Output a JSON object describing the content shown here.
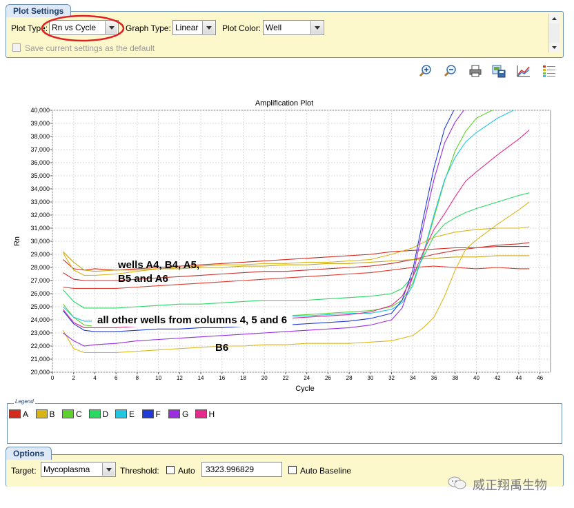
{
  "plot_settings": {
    "title": "Plot Settings",
    "plot_type_label": "Plot Type:",
    "plot_type_value": "Rn vs Cycle",
    "graph_type_label": "Graph Type:",
    "graph_type_value": "Linear",
    "plot_color_label": "Plot Color:",
    "plot_color_value": "Well",
    "save_default_label": "Save current settings as the default",
    "save_default_checked": false
  },
  "toolbar": {
    "icons": [
      "zoom-in-icon",
      "zoom-out-icon",
      "print-icon",
      "save-image-icon",
      "chart-icon",
      "legend-list-icon"
    ]
  },
  "chart_data": {
    "type": "line",
    "title": "Amplification Plot",
    "xlabel": "Cycle",
    "ylabel": "Rn",
    "xlim": [
      0,
      47
    ],
    "ylim": [
      20000,
      40000
    ],
    "x_ticks": [
      0,
      2,
      4,
      6,
      8,
      10,
      12,
      14,
      16,
      18,
      20,
      22,
      24,
      26,
      28,
      30,
      32,
      34,
      36,
      38,
      40,
      42,
      44,
      46
    ],
    "y_ticks": [
      20000,
      21000,
      22000,
      23000,
      24000,
      25000,
      26000,
      27000,
      28000,
      29000,
      30000,
      31000,
      32000,
      33000,
      34000,
      35000,
      36000,
      37000,
      38000,
      39000,
      40000
    ],
    "y_tick_labels": [
      "20,000",
      "21,000",
      "22,000",
      "23,000",
      "24,000",
      "25,000",
      "26,000",
      "27,000",
      "28,000",
      "29,000",
      "30,000",
      "31,000",
      "32,000",
      "33,000",
      "34,000",
      "35,000",
      "36,000",
      "37,000",
      "38,000",
      "39,000",
      "40,000"
    ],
    "grid": true,
    "series": [
      {
        "name": "A",
        "color": "#d52b1e",
        "x": [
          1,
          2,
          3,
          4,
          6,
          8,
          10,
          12,
          14,
          16,
          18,
          20,
          22,
          24,
          26,
          28,
          30,
          32,
          34,
          36,
          38,
          40,
          42,
          44,
          45
        ],
        "values": [
          28600,
          27900,
          27800,
          27900,
          27800,
          27900,
          28000,
          28100,
          28200,
          28300,
          28400,
          28500,
          28600,
          28700,
          28800,
          28900,
          29000,
          29200,
          29300,
          29400,
          29500,
          29500,
          29600,
          29600,
          29600
        ]
      },
      {
        "name": "A",
        "color": "#c9302c",
        "x": [
          1,
          2,
          3,
          4,
          6,
          8,
          10,
          12,
          14,
          16,
          18,
          20,
          22,
          24,
          26,
          28,
          30,
          32,
          34,
          36,
          38,
          40,
          42,
          44,
          45
        ],
        "values": [
          27600,
          27100,
          27000,
          27000,
          27000,
          27100,
          27200,
          27300,
          27400,
          27500,
          27600,
          27700,
          27700,
          27800,
          27900,
          28000,
          28100,
          28300,
          28600,
          29000,
          29300,
          29500,
          29700,
          29800,
          29900
        ]
      },
      {
        "name": "A",
        "color": "#e03a2a",
        "x": [
          1,
          2,
          3,
          4,
          6,
          8,
          10,
          12,
          14,
          16,
          18,
          20,
          22,
          24,
          26,
          28,
          30,
          32,
          34,
          36,
          38,
          40,
          42,
          44,
          45
        ],
        "values": [
          26500,
          26400,
          26400,
          26400,
          26400,
          26500,
          26600,
          26700,
          26800,
          26900,
          27000,
          27100,
          27200,
          27300,
          27400,
          27500,
          27600,
          27800,
          28000,
          28100,
          28000,
          27900,
          28000,
          27900,
          27900
        ]
      },
      {
        "name": "B",
        "color": "#d8b415",
        "x": [
          1,
          2,
          3,
          4,
          6,
          8,
          10,
          12,
          14,
          16,
          18,
          20,
          22,
          24,
          26,
          28,
          30,
          32,
          34,
          36,
          38,
          40,
          42,
          44,
          45
        ],
        "values": [
          29100,
          27800,
          27400,
          27400,
          27500,
          27700,
          27900,
          28000,
          28100,
          28200,
          28200,
          28300,
          28300,
          28400,
          28400,
          28500,
          28600,
          29000,
          29500,
          30300,
          30700,
          30900,
          31000,
          31000,
          31100
        ]
      },
      {
        "name": "B",
        "color": "#c9a810",
        "x": [
          1,
          2,
          3,
          4,
          6,
          8,
          10,
          12,
          14,
          16,
          18,
          20,
          22,
          24,
          26,
          28,
          30,
          32,
          34,
          36,
          38,
          40,
          42,
          44,
          45
        ],
        "values": [
          29200,
          28400,
          27800,
          27700,
          27800,
          27800,
          27900,
          27900,
          28000,
          28000,
          28100,
          28100,
          28200,
          28200,
          28300,
          28300,
          28400,
          28500,
          28600,
          28700,
          28800,
          28800,
          28900,
          28900,
          28900
        ]
      },
      {
        "name": "B",
        "color": "#dcb81a",
        "x": [
          1,
          2,
          3,
          4,
          6,
          8,
          10,
          12,
          14,
          16,
          18,
          20,
          22,
          24,
          26,
          28,
          30,
          32,
          34,
          35,
          36,
          37,
          38,
          39,
          40,
          42,
          44,
          45
        ],
        "values": [
          23200,
          21800,
          21500,
          21500,
          21500,
          21600,
          21700,
          21800,
          21900,
          22000,
          22000,
          22100,
          22100,
          22200,
          22200,
          22200,
          22300,
          22400,
          22800,
          23400,
          24200,
          25800,
          27800,
          29400,
          30100,
          31300,
          32400,
          33000
        ]
      },
      {
        "name": "C",
        "color": "#5bd12a",
        "x": [
          1,
          2,
          3,
          4,
          6,
          8,
          10,
          12,
          14,
          16,
          18,
          20,
          22,
          24,
          26,
          28,
          30,
          32,
          33,
          34,
          35,
          36,
          37,
          38,
          39,
          40,
          42,
          44,
          45
        ],
        "values": [
          25200,
          24200,
          23600,
          23500,
          23500,
          23600,
          23700,
          23800,
          23900,
          24000,
          24100,
          24200,
          24300,
          24400,
          24500,
          24600,
          24700,
          25000,
          25500,
          26800,
          29000,
          31800,
          34600,
          36900,
          38400,
          39400,
          40200,
          40600,
          40800
        ]
      },
      {
        "name": "D",
        "color": "#2ad864",
        "x": [
          1,
          2,
          3,
          4,
          6,
          8,
          10,
          12,
          14,
          16,
          18,
          20,
          22,
          24,
          26,
          28,
          30,
          32,
          33,
          34,
          35,
          36,
          37,
          38,
          39,
          40,
          42,
          44,
          45
        ],
        "values": [
          26300,
          25400,
          24900,
          24900,
          24900,
          25000,
          25100,
          25200,
          25200,
          25300,
          25400,
          25500,
          25500,
          25500,
          25600,
          25700,
          25800,
          26000,
          26400,
          27300,
          28800,
          30400,
          31300,
          31800,
          32200,
          32500,
          33000,
          33500,
          33700
        ]
      },
      {
        "name": "E",
        "color": "#22c6e0",
        "x": [
          1,
          2,
          3,
          4,
          6,
          8,
          10,
          12,
          14,
          16,
          18,
          20,
          22,
          24,
          26,
          28,
          30,
          32,
          33,
          34,
          35,
          36,
          37,
          38,
          39,
          40,
          42,
          44
        ],
        "values": [
          25000,
          24200,
          23900,
          23900,
          23900,
          24000,
          24000,
          24100,
          24100,
          24200,
          24200,
          24300,
          24300,
          24300,
          24400,
          24500,
          24500,
          24800,
          25300,
          26600,
          29100,
          32000,
          34700,
          36400,
          37600,
          38300,
          39400,
          40200
        ]
      },
      {
        "name": "F",
        "color": "#1f3ad6",
        "x": [
          1,
          2,
          3,
          4,
          6,
          8,
          10,
          12,
          14,
          16,
          18,
          20,
          22,
          24,
          26,
          28,
          30,
          32,
          33,
          34,
          35,
          36,
          37,
          38
        ],
        "values": [
          24700,
          23700,
          23200,
          23100,
          23100,
          23200,
          23300,
          23300,
          23400,
          23400,
          23500,
          23500,
          23600,
          23700,
          23800,
          23900,
          24100,
          24500,
          25500,
          27800,
          31800,
          35600,
          38600,
          40200
        ]
      },
      {
        "name": "G",
        "color": "#9a2ee0",
        "x": [
          1,
          2,
          3,
          4,
          6,
          8,
          10,
          12,
          14,
          16,
          18,
          20,
          22,
          24,
          26,
          28,
          30,
          32,
          33,
          34,
          35,
          36,
          37,
          38,
          39,
          40,
          42,
          44
        ],
        "values": [
          23000,
          22400,
          22000,
          22100,
          22200,
          22400,
          22500,
          22600,
          22700,
          22800,
          22900,
          23000,
          23100,
          23200,
          23300,
          23400,
          23600,
          24000,
          24900,
          27300,
          31200,
          34700,
          37500,
          39100,
          40200,
          40800,
          41200,
          41500
        ]
      },
      {
        "name": "H",
        "color": "#e62a8c",
        "x": [
          1,
          2,
          3,
          4,
          6,
          8,
          10,
          12,
          14,
          16,
          18,
          20,
          22,
          24,
          26,
          28,
          30,
          32,
          33,
          34,
          35,
          36,
          37,
          38,
          39,
          40,
          42,
          44,
          45
        ],
        "values": [
          24800,
          23800,
          23400,
          23400,
          23400,
          23500,
          23600,
          23700,
          23800,
          23800,
          23900,
          24000,
          24100,
          24200,
          24300,
          24400,
          24600,
          25100,
          25800,
          27300,
          29200,
          30900,
          32100,
          33400,
          34600,
          35300,
          36600,
          37800,
          38500
        ]
      }
    ],
    "annotations": [
      {
        "text": "wells A4, B4, A5, B5 and A6"
      },
      {
        "text": "all other wells from columns 4, 5 and 6"
      },
      {
        "text": "B6"
      }
    ]
  },
  "legend": {
    "title": "Legend",
    "items": [
      {
        "label": "A",
        "color": "#d52b1e"
      },
      {
        "label": "B",
        "color": "#d8b415"
      },
      {
        "label": "C",
        "color": "#5bd12a"
      },
      {
        "label": "D",
        "color": "#2ad864"
      },
      {
        "label": "E",
        "color": "#22c6e0"
      },
      {
        "label": "F",
        "color": "#1f3ad6"
      },
      {
        "label": "G",
        "color": "#9a2ee0"
      },
      {
        "label": "H",
        "color": "#e62a8c"
      }
    ]
  },
  "options": {
    "title": "Options",
    "target_label": "Target:",
    "target_value": "Mycoplasma",
    "threshold_label": "Threshold:",
    "auto_label": "Auto",
    "threshold_value": "3323.996829",
    "auto_baseline_label": "Auto Baseline"
  },
  "watermark": "威正翔禹生物",
  "colors": {
    "panel_bg": "#fcf8cc",
    "border": "#6b8fb5",
    "highlight": "#e02020"
  }
}
